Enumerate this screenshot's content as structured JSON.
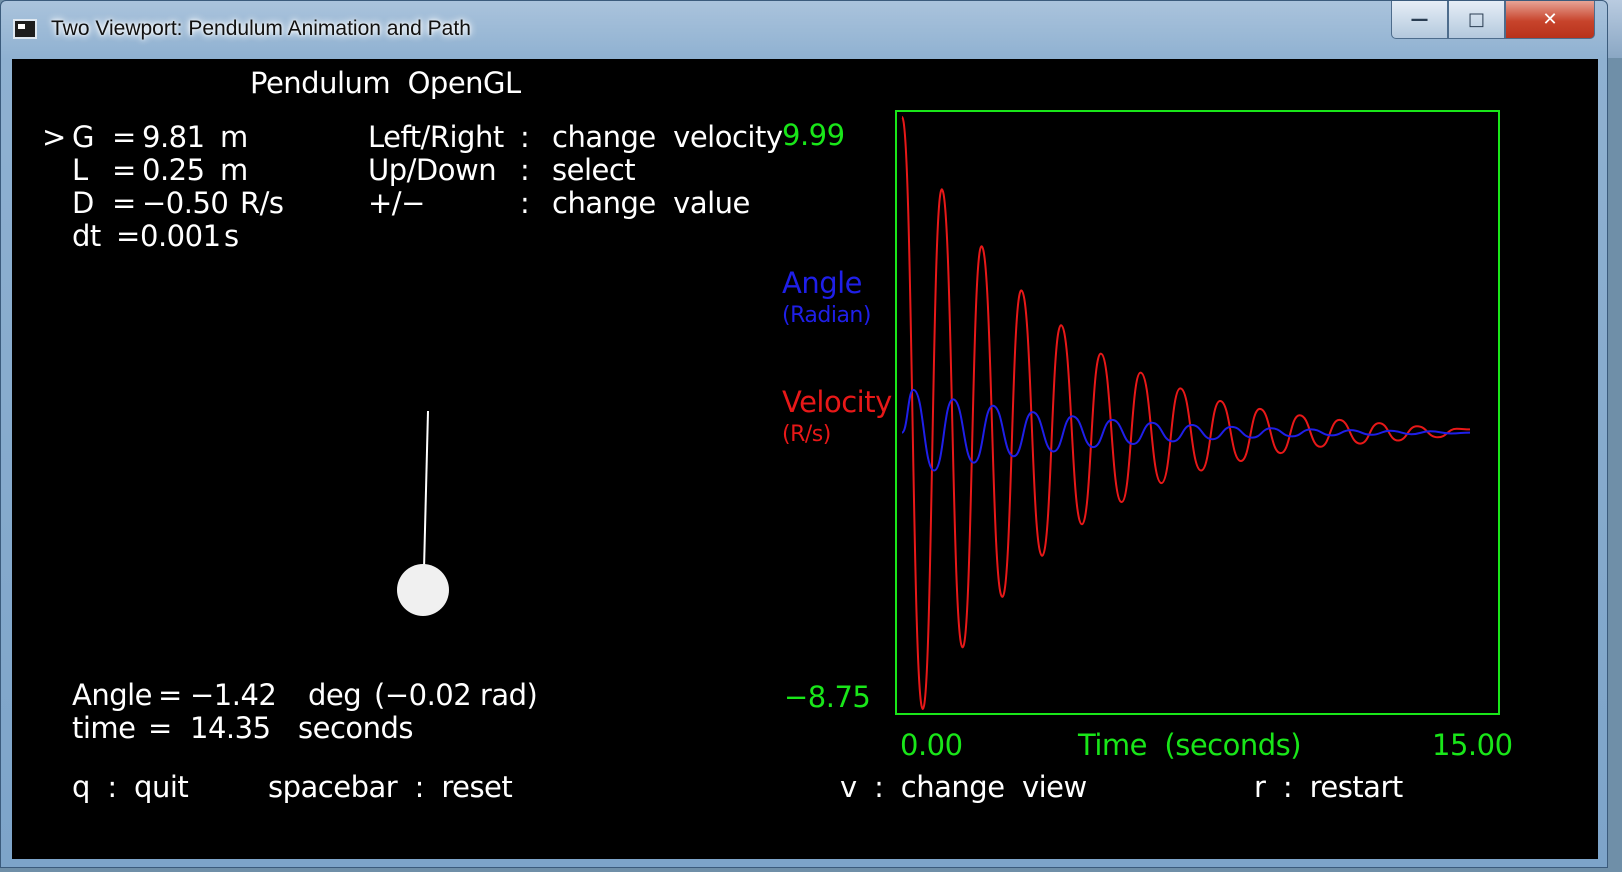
{
  "window": {
    "title": "Two Viewport: Pendulum Animation and Path",
    "controls": {
      "minimize": "—",
      "maximize": "□",
      "close": "✕"
    }
  },
  "pendulum_view": {
    "title": "Pendulum  OpenGL",
    "params": [
      {
        "cursor": ">",
        "label": "G",
        "eq": "=",
        "value": "9.81",
        "unit": "m"
      },
      {
        "cursor": "",
        "label": "L",
        "eq": "=",
        "value": "0.25",
        "unit": "m"
      },
      {
        "cursor": "",
        "label": "D",
        "eq": "=",
        "value": "−0.50",
        "unit": "R/s"
      },
      {
        "cursor": "",
        "label": "dt",
        "eq": "=",
        "value": "0.001",
        "unit": "s"
      }
    ],
    "help": [
      {
        "key": "Left/Right",
        "sep": ":",
        "action": "change  velocity"
      },
      {
        "key": "Up/Down",
        "sep": ":",
        "action": "select"
      },
      {
        "key": "+/−",
        "sep": ":",
        "action": "change  value"
      }
    ],
    "readout": {
      "angle_label": "Angle",
      "angle_eq": "=",
      "angle_value": "−1.42",
      "angle_unit": "deg",
      "angle_rad": "(−0.02 rad)",
      "time_label": "time",
      "time_eq": "=",
      "time_value": "14.35",
      "time_unit": "seconds"
    },
    "footer": {
      "quit_key": "q  :  quit",
      "reset_key": "spacebar  :  reset"
    }
  },
  "graph_view": {
    "angle_label": "Angle",
    "angle_unit": "(Radian)",
    "velocity_label": "Velocity",
    "velocity_unit": "(R/s)",
    "y_max_label": "9.99",
    "y_min_label": "−8.75",
    "x_min_label": "0.00",
    "x_max_label": "15.00",
    "x_title": "Time  (seconds)",
    "footer": {
      "view_key": "v  :  change  view",
      "restart_key": "r  :  restart"
    },
    "colors": {
      "frame": "#19e619",
      "velocity": "#e81818",
      "angle": "#1f1fe8"
    }
  },
  "chart_data": {
    "type": "line",
    "xlabel": "Time  (seconds)",
    "ylabel": "",
    "xlim": [
      0,
      15
    ],
    "ylim": [
      -8.75,
      9.99
    ],
    "series": [
      {
        "name": "Velocity",
        "color": "#e81818",
        "x": [
          0.0,
          0.55,
          1.05,
          1.6,
          2.1,
          2.65,
          3.15,
          3.7,
          4.2,
          4.75,
          5.25,
          5.8,
          6.3,
          6.85,
          7.35,
          7.9,
          8.4,
          8.95,
          9.45,
          10.0,
          10.5,
          11.05,
          11.55,
          12.1,
          12.6,
          13.1,
          13.6,
          14.15,
          14.65,
          15.0
        ],
        "values": [
          9.99,
          -8.75,
          7.7,
          -6.8,
          5.9,
          -5.2,
          4.5,
          -3.9,
          3.4,
          -2.9,
          2.5,
          -2.2,
          1.9,
          -1.6,
          1.4,
          -1.2,
          1.0,
          -0.9,
          0.75,
          -0.65,
          0.55,
          -0.45,
          0.4,
          -0.35,
          0.3,
          -0.25,
          0.2,
          -0.15,
          0.12,
          0.1
        ]
      },
      {
        "name": "Angle",
        "color": "#1f1fe8",
        "x": [
          0.0,
          0.3,
          0.85,
          1.35,
          1.9,
          2.4,
          2.95,
          3.45,
          4.0,
          4.5,
          5.05,
          5.55,
          6.1,
          6.6,
          7.15,
          7.65,
          8.2,
          8.7,
          9.25,
          9.75,
          10.3,
          10.8,
          11.35,
          11.85,
          12.4,
          12.9,
          13.45,
          13.95,
          14.5,
          15.0
        ],
        "values": [
          0.0,
          1.35,
          -1.2,
          1.05,
          -0.95,
          0.85,
          -0.75,
          0.65,
          -0.6,
          0.52,
          -0.46,
          0.4,
          -0.36,
          0.31,
          -0.28,
          0.24,
          -0.21,
          0.18,
          -0.16,
          0.14,
          -0.12,
          0.1,
          -0.09,
          0.08,
          -0.07,
          0.06,
          -0.05,
          0.04,
          -0.03,
          0.0
        ]
      }
    ]
  }
}
